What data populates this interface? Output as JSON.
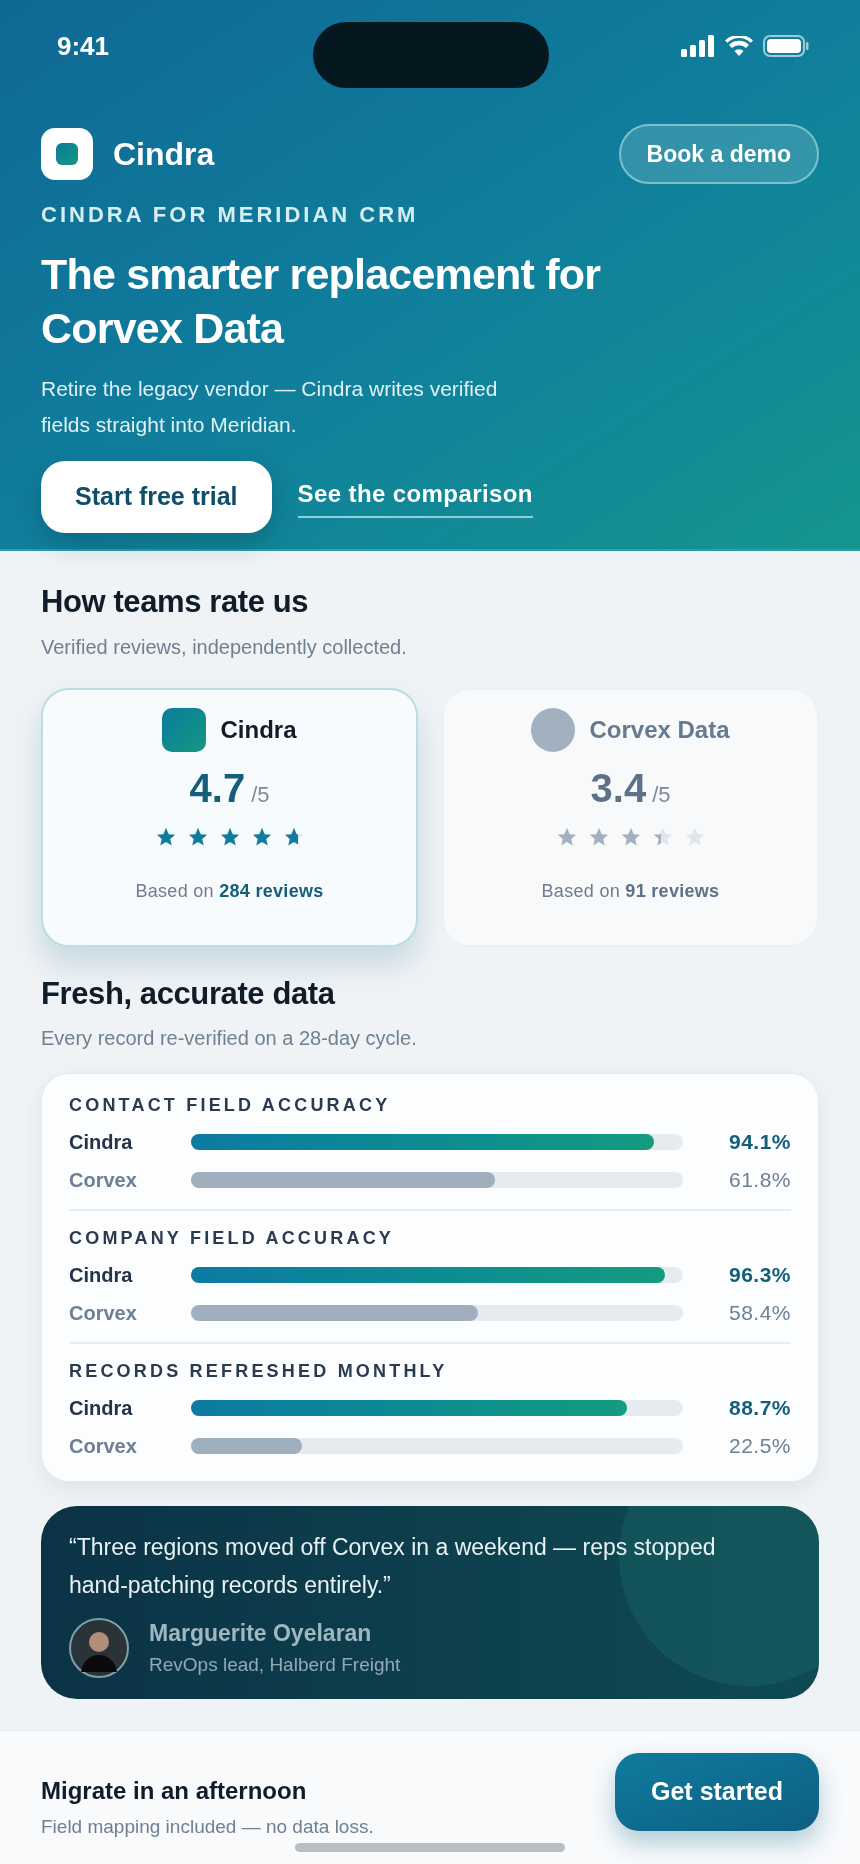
{
  "status_bar": {
    "time": "9:41"
  },
  "header": {
    "brand": "Cindra",
    "demo_button": "Book a demo",
    "eyebrow": "CINDRA FOR MERIDIAN CRM",
    "title": "The smarter replacement for Corvex Data",
    "subtitle": "Retire the legacy vendor — Cindra writes verified fields straight into Meridian.",
    "primary_button": "Start free trial",
    "link": "See the comparison"
  },
  "ratings": {
    "title": "How teams rate us",
    "subtitle": "Verified reviews, independently collected.",
    "cards": [
      {
        "name": "Cindra",
        "highlighted": true,
        "score": "4.7",
        "scale": "/5",
        "stars": 4.7,
        "reviews_prefix": "Based on",
        "reviews": "284 reviews"
      },
      {
        "name": "Corvex Data",
        "highlighted": false,
        "score": "3.4",
        "scale": "/5",
        "stars": 3.4,
        "reviews_prefix": "Based on",
        "reviews": "91 reviews"
      }
    ]
  },
  "accuracy": {
    "title": "Fresh, accurate data",
    "subtitle": "Every record re-verified on a 28-day cycle.",
    "groups": [
      {
        "label": "CONTACT FIELD ACCURACY",
        "rows": [
          {
            "kind": "primary",
            "name": "Cindra",
            "level": 0.941,
            "reading": "94.1%"
          },
          {
            "kind": "competitor",
            "name": "Corvex",
            "level": 0.618,
            "reading": "61.8%"
          }
        ]
      },
      {
        "label": "COMPANY FIELD ACCURACY",
        "rows": [
          {
            "kind": "primary",
            "name": "Cindra",
            "level": 0.963,
            "reading": "96.3%"
          },
          {
            "kind": "competitor",
            "name": "Corvex",
            "level": 0.584,
            "reading": "58.4%"
          }
        ]
      },
      {
        "label": "RECORDS REFRESHED MONTHLY",
        "rows": [
          {
            "kind": "primary",
            "name": "Cindra",
            "level": 0.887,
            "reading": "88.7%"
          },
          {
            "kind": "competitor",
            "name": "Corvex",
            "level": 0.225,
            "reading": "22.5%"
          }
        ]
      }
    ]
  },
  "testimonial": {
    "quote": "“Three regions moved off Corvex in a weekend — reps stopped hand-patching records entirely.”",
    "author": "Marguerite Oyelaran",
    "role": "RevOps lead, Halberd Freight"
  },
  "bottom_bar": {
    "title": "Migrate in an afternoon",
    "subtitle": "Field mapping included — no data loss.",
    "button": "Get started"
  }
}
